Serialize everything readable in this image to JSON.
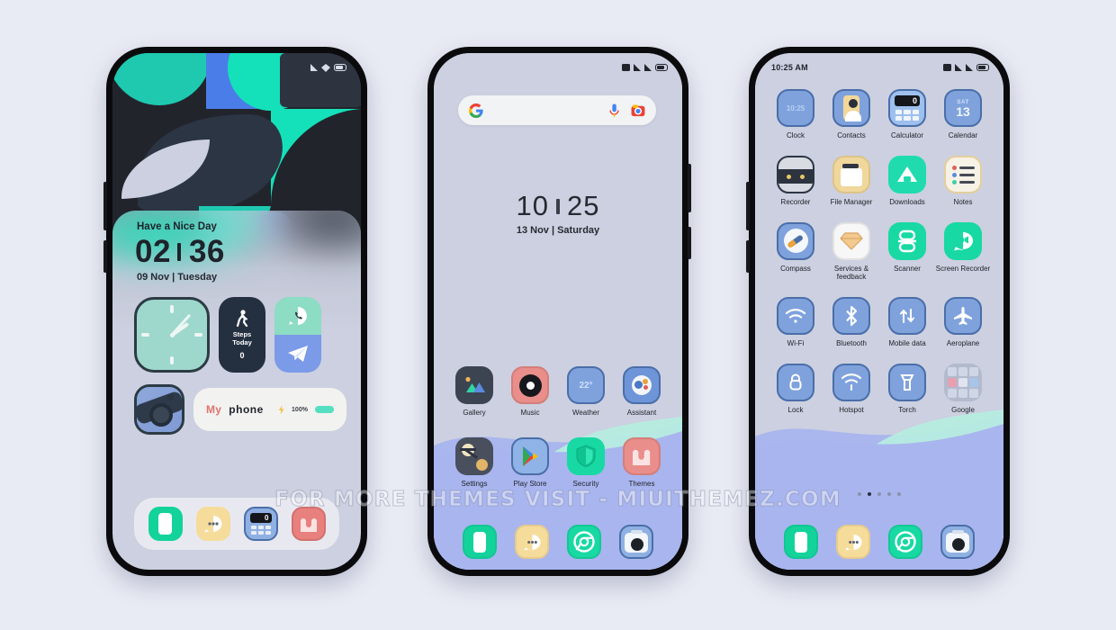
{
  "background_color": "#e9ebf4",
  "watermark": "FOR MORE THEMES VISIT - MIUITHEMEZ.COM",
  "phone1": {
    "name": "lockscreen-phone",
    "statusbar": {
      "time": "",
      "icons": [
        "signal-icon",
        "wifi-icon",
        "battery-icon"
      ]
    },
    "greeting": "Have a Nice Day",
    "clock": {
      "hours": "02",
      "minutes": "36"
    },
    "date": "09 Nov | Tuesday",
    "widgets": {
      "analog_clock": "analog-clock-widget",
      "steps": {
        "label_line1": "Steps",
        "label_line2": "Today",
        "value": "0"
      },
      "comm": {
        "top": "phone-call-icon",
        "bottom": "telegram-icon"
      },
      "camera": "camera-widget",
      "battery": {
        "brand_prefix": "My",
        "brand_suffix": "phone",
        "percent": "100%"
      }
    },
    "dock": [
      "Phone",
      "Messages",
      "Calculator",
      "Themes"
    ]
  },
  "phone2": {
    "name": "homescreen-phone",
    "statusbar": {
      "time": "",
      "icons": [
        "sim-icon",
        "signal-icon",
        "signal-icon",
        "battery-icon"
      ]
    },
    "search": {
      "placeholder": "",
      "leading_icon": "google-g-icon",
      "mic_icon": "microphone-icon",
      "lens_icon": "google-lens-icon"
    },
    "clock": {
      "hours": "10",
      "minutes": "25"
    },
    "date": "13 Nov | Saturday",
    "apps": [
      {
        "name": "Gallery",
        "icon": "gallery-icon"
      },
      {
        "name": "Music",
        "icon": "music-icon"
      },
      {
        "name": "Weather",
        "icon": "weather-icon",
        "badge": "22°"
      },
      {
        "name": "Assistant",
        "icon": "assistant-icon"
      },
      {
        "name": "Settings",
        "icon": "settings-icon"
      },
      {
        "name": "Play Store",
        "icon": "play-store-icon"
      },
      {
        "name": "Security",
        "icon": "security-icon"
      },
      {
        "name": "Themes",
        "icon": "themes-icon"
      }
    ],
    "dock": [
      "Phone",
      "Messages",
      "Browser",
      "Camera"
    ]
  },
  "phone3": {
    "name": "apps-page-phone",
    "statusbar": {
      "time": "10:25 AM",
      "icons": [
        "sim-icon",
        "signal-icon",
        "signal-icon",
        "battery-icon"
      ]
    },
    "apps": [
      {
        "name": "Clock",
        "icon": "clock-icon",
        "badge": "10:25"
      },
      {
        "name": "Contacts",
        "icon": "contacts-icon"
      },
      {
        "name": "Calculator",
        "icon": "calculator-icon",
        "badge": "0"
      },
      {
        "name": "Calendar",
        "icon": "calendar-icon",
        "badge_top": "SAT",
        "badge": "13"
      },
      {
        "name": "Recorder",
        "icon": "recorder-icon"
      },
      {
        "name": "File Manager",
        "icon": "file-manager-icon"
      },
      {
        "name": "Downloads",
        "icon": "downloads-icon"
      },
      {
        "name": "Notes",
        "icon": "notes-icon"
      },
      {
        "name": "Compass",
        "icon": "compass-icon"
      },
      {
        "name": "Services & feedback",
        "icon": "services-feedback-icon"
      },
      {
        "name": "Scanner",
        "icon": "scanner-icon"
      },
      {
        "name": "Screen Recorder",
        "icon": "screen-recorder-icon"
      },
      {
        "name": "Wi-Fi",
        "icon": "wifi-icon"
      },
      {
        "name": "Bluetooth",
        "icon": "bluetooth-icon"
      },
      {
        "name": "Mobile data",
        "icon": "mobile-data-icon"
      },
      {
        "name": "Aeroplane",
        "icon": "aeroplane-icon"
      },
      {
        "name": "Lock",
        "icon": "lock-icon"
      },
      {
        "name": "Hotspot",
        "icon": "hotspot-icon"
      },
      {
        "name": "Torch",
        "icon": "torch-icon"
      },
      {
        "name": "Google",
        "icon": "google-folder-icon"
      }
    ],
    "page_dots": {
      "count": 5,
      "active_index": 1
    },
    "dock": [
      "Phone",
      "Messages",
      "Browser",
      "Camera"
    ]
  },
  "palette": {
    "teal": "#14e1b9",
    "mint": "#8ddcc4",
    "periwinkle": "#a9b5ee",
    "blue_tile": "#7fa2dd",
    "dark_navy": "#243040",
    "screen_bg": "#ccd0e0"
  }
}
